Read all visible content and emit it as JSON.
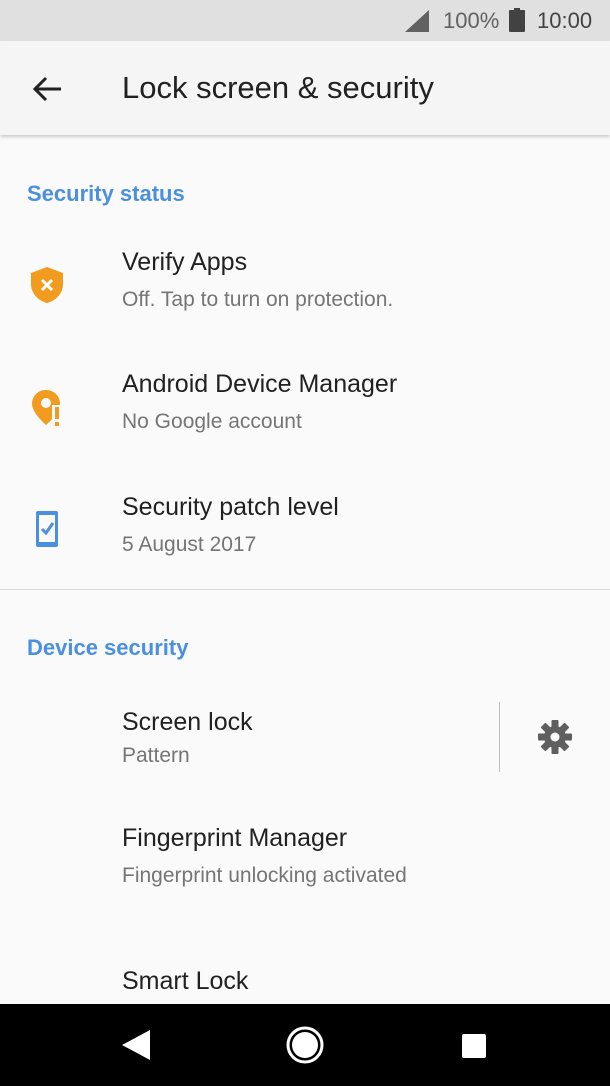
{
  "status_bar": {
    "battery_percent": "100%",
    "time": "10:00",
    "icons": [
      "signal-icon",
      "battery-icon"
    ]
  },
  "toolbar": {
    "title": "Lock screen & security",
    "back_icon": "back-arrow-icon"
  },
  "security_status": {
    "header": "Security status",
    "items": [
      {
        "title": "Verify Apps",
        "subtitle": "Off. Tap to turn on protection.",
        "icon": "shield-warning-icon",
        "icon_color": "#f29c1f"
      },
      {
        "title": "Android Device Manager",
        "subtitle": "No Google account",
        "icon": "location-alert-icon",
        "icon_color": "#f29c1f"
      },
      {
        "title": "Security patch level",
        "subtitle": "5 August 2017",
        "icon": "phone-check-icon",
        "icon_color": "#4a8fe0"
      }
    ]
  },
  "device_security": {
    "header": "Device security",
    "items": [
      {
        "title": "Screen lock",
        "subtitle": "Pattern",
        "action_icon": "gear-icon"
      },
      {
        "title": "Fingerprint Manager",
        "subtitle": "Fingerprint unlocking activated"
      },
      {
        "title": "Smart Lock"
      }
    ]
  },
  "nav_bar": {
    "buttons": [
      "back-triangle-icon",
      "home-circle-icon",
      "recents-square-icon"
    ]
  },
  "colors": {
    "accent": "#4a8fe0",
    "warning": "#f29c1f",
    "status_bar_bg": "#e0e0e0",
    "nav_bar_bg": "#000000"
  }
}
